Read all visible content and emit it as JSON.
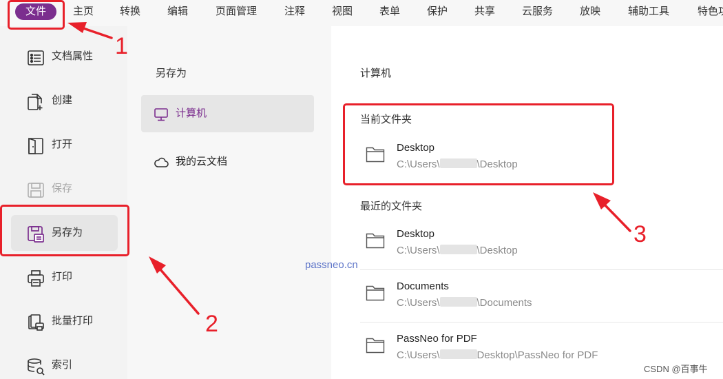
{
  "menubar": {
    "file": "文件",
    "items": [
      "主页",
      "转换",
      "编辑",
      "页面管理",
      "注释",
      "视图",
      "表单",
      "保护",
      "共享",
      "云服务",
      "放映",
      "辅助工具",
      "特色功能"
    ]
  },
  "leftnav": {
    "items": [
      {
        "label": "文档属性",
        "icon": "document-properties-icon"
      },
      {
        "label": "创建",
        "icon": "create-icon"
      },
      {
        "label": "打开",
        "icon": "open-icon"
      },
      {
        "label": "保存",
        "icon": "save-icon"
      },
      {
        "label": "另存为",
        "icon": "save-as-icon"
      },
      {
        "label": "打印",
        "icon": "print-icon"
      },
      {
        "label": "批量打印",
        "icon": "batch-print-icon"
      },
      {
        "label": "索引",
        "icon": "index-icon"
      }
    ]
  },
  "middle": {
    "title": "另存为",
    "options": [
      {
        "label": "计算机",
        "icon": "computer-icon"
      },
      {
        "label": "我的云文档",
        "icon": "cloud-icon"
      }
    ]
  },
  "right": {
    "heading": "计算机",
    "current_folder_label": "当前文件夹",
    "current_folder": {
      "name": "Desktop",
      "path_before": "C:\\Users\\",
      "path_after": "\\Desktop"
    },
    "recent_label": "最近的文件夹",
    "recent": [
      {
        "name": "Desktop",
        "path_before": "C:\\Users\\",
        "path_after": "\\Desktop"
      },
      {
        "name": "Documents",
        "path_before": "C:\\Users\\",
        "path_after": "\\Documents"
      },
      {
        "name": "PassNeo for PDF",
        "path_before": "C:\\Users\\",
        "path_after": "Desktop\\PassNeo for PDF"
      }
    ]
  },
  "annotations": {
    "one": "1",
    "two": "2",
    "three": "3"
  },
  "watermark": "passneo.cn",
  "credit": "CSDN @百事牛",
  "colors": {
    "accent": "#7b2e8e",
    "annotation": "#e8202a",
    "watermark": "#5f76c9"
  }
}
